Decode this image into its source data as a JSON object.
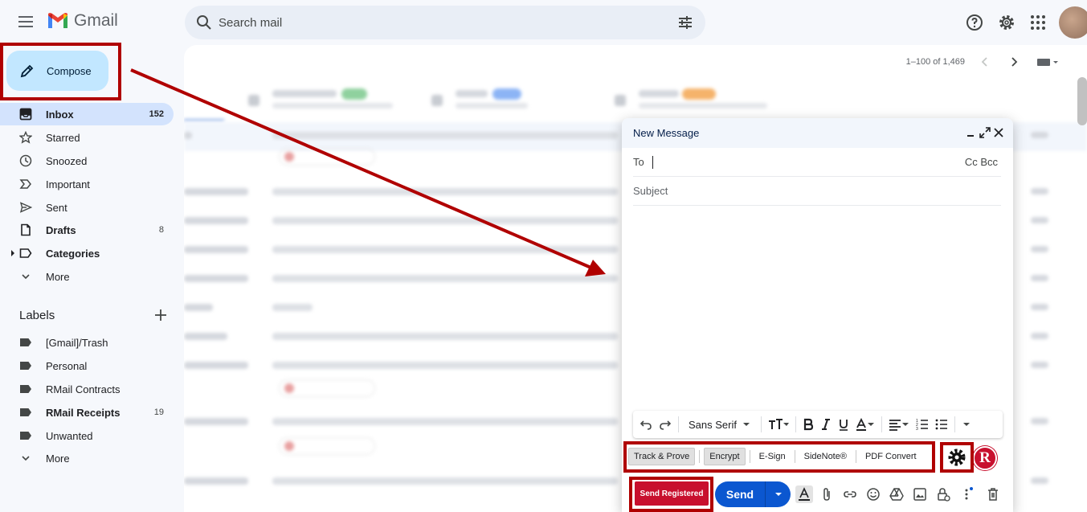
{
  "header": {
    "app_name": "Gmail",
    "search_placeholder": "Search mail"
  },
  "sidebar": {
    "compose_label": "Compose",
    "items": [
      {
        "label": "Inbox",
        "count": "152"
      },
      {
        "label": "Starred",
        "count": ""
      },
      {
        "label": "Snoozed",
        "count": ""
      },
      {
        "label": "Important",
        "count": ""
      },
      {
        "label": "Sent",
        "count": ""
      },
      {
        "label": "Drafts",
        "count": "8"
      },
      {
        "label": "Categories",
        "count": ""
      },
      {
        "label": "More",
        "count": ""
      }
    ],
    "labels_heading": "Labels",
    "labels": [
      {
        "label": "[Gmail]/Trash",
        "count": ""
      },
      {
        "label": "Personal",
        "count": ""
      },
      {
        "label": "RMail Contracts",
        "count": ""
      },
      {
        "label": "RMail Receipts",
        "count": "19"
      },
      {
        "label": "Unwanted",
        "count": ""
      },
      {
        "label": "More",
        "count": ""
      }
    ]
  },
  "main": {
    "pagination": "1–100 of 1,469"
  },
  "compose_window": {
    "title": "New Message",
    "to_label": "To",
    "cc_bcc_label": "Cc Bcc",
    "subject_placeholder": "Subject",
    "font_name": "Sans Serif",
    "rmail_buttons": {
      "track_prove": "Track & Prove",
      "encrypt": "Encrypt",
      "esign": "E-Sign",
      "sidenote": "SideNote®",
      "pdf_convert": "PDF Convert"
    },
    "r_logo": "R",
    "send_registered_label": "Send Registered",
    "send_label": "Send"
  },
  "colors": {
    "accent": "#0b57d0",
    "compose_bg": "#c2e7ff",
    "rmail_red": "#c8102e",
    "annotation": "#b00000"
  }
}
